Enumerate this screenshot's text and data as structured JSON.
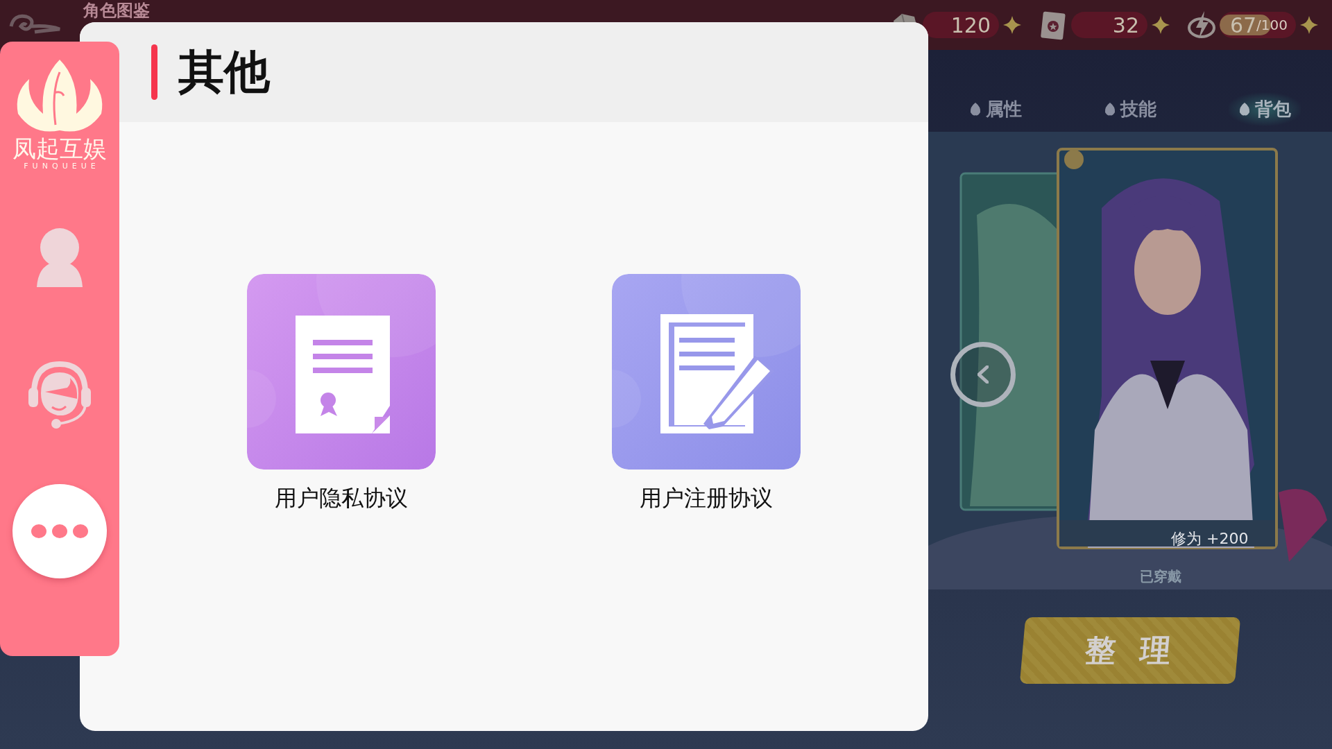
{
  "game": {
    "title": "角色图鉴",
    "resources": [
      {
        "kind": "gems",
        "value": "120"
      },
      {
        "kind": "cards",
        "value": "32"
      },
      {
        "kind": "energy",
        "value": "67",
        "max": "/100",
        "level": 0.67
      }
    ],
    "tabs": [
      {
        "label": "属性",
        "selected": false
      },
      {
        "label": "技能",
        "selected": false
      },
      {
        "label": "背包",
        "selected": true
      }
    ],
    "card": {
      "bonus": "修为 +200",
      "status": "已穿戴"
    },
    "action_button": "整理"
  },
  "sidebar": {
    "logo": {
      "name": "凤起互娱",
      "tagline": "FUNQUEUE"
    },
    "items": [
      {
        "kind": "profile",
        "selected": false
      },
      {
        "kind": "support",
        "selected": false
      },
      {
        "kind": "more",
        "selected": true
      }
    ]
  },
  "dialog": {
    "title": "其他",
    "items": [
      {
        "kind": "privacy",
        "label": "用户隐私协议"
      },
      {
        "kind": "register",
        "label": "用户注册协议"
      }
    ]
  }
}
